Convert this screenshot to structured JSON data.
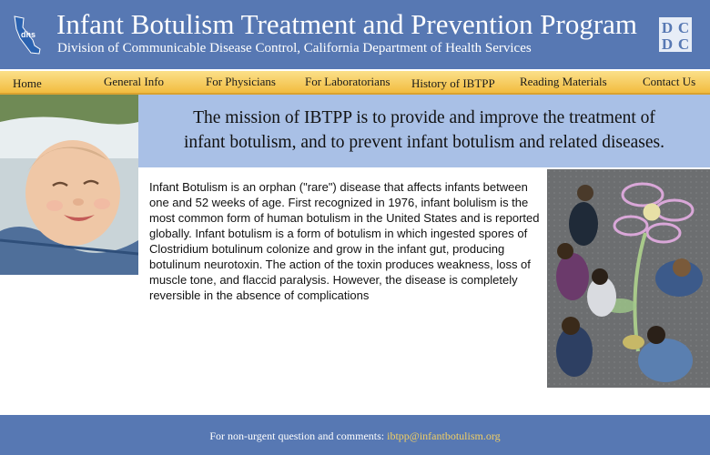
{
  "header": {
    "title": "Infant Botulism Treatment and Prevention Program",
    "subtitle": "Division of Communicable Disease Control, California Department of Health Services",
    "logo_left_icon": "california-dhs-logo-icon",
    "logo_right_icon": "dcdc-logo-icon"
  },
  "nav": {
    "items": [
      {
        "label": "Home"
      },
      {
        "label": "General Info"
      },
      {
        "label": "For Physicians"
      },
      {
        "label": "For Laboratorians"
      },
      {
        "label": "History of IBTPP"
      },
      {
        "label": "Reading Materials"
      },
      {
        "label": "Contact Us"
      }
    ]
  },
  "mission": {
    "line1": "The mission of IBTPP is to provide and improve the treatment of",
    "line2": "infant botulism, and to prevent infant botulism and related diseases."
  },
  "main": {
    "paragraph": "Infant Botulism is an orphan (\"rare\") disease that affects infants between one and 52 weeks of age. First recognized in 1976, infant bolulism is the most common form of human botulism in the United States and is reported globally. Infant botulism is a form of botulism in which ingested spores of Clostridium botulinum colonize and grow in the infant gut, producing botulinum neurotoxin. The action of the toxin produces weakness, loss of muscle tone, and flaccid paralysis. However, the disease is completely reversible in the absence of complications"
  },
  "footer": {
    "prefix": "For non-urgent question and comments:",
    "email": "ibtpp@infantbotulism.org"
  },
  "colors": {
    "header_bg": "#5778b3",
    "nav_bg": "#f2bc3f",
    "mission_bg": "#a9c0e6",
    "footer_link": "#f2cf63"
  }
}
